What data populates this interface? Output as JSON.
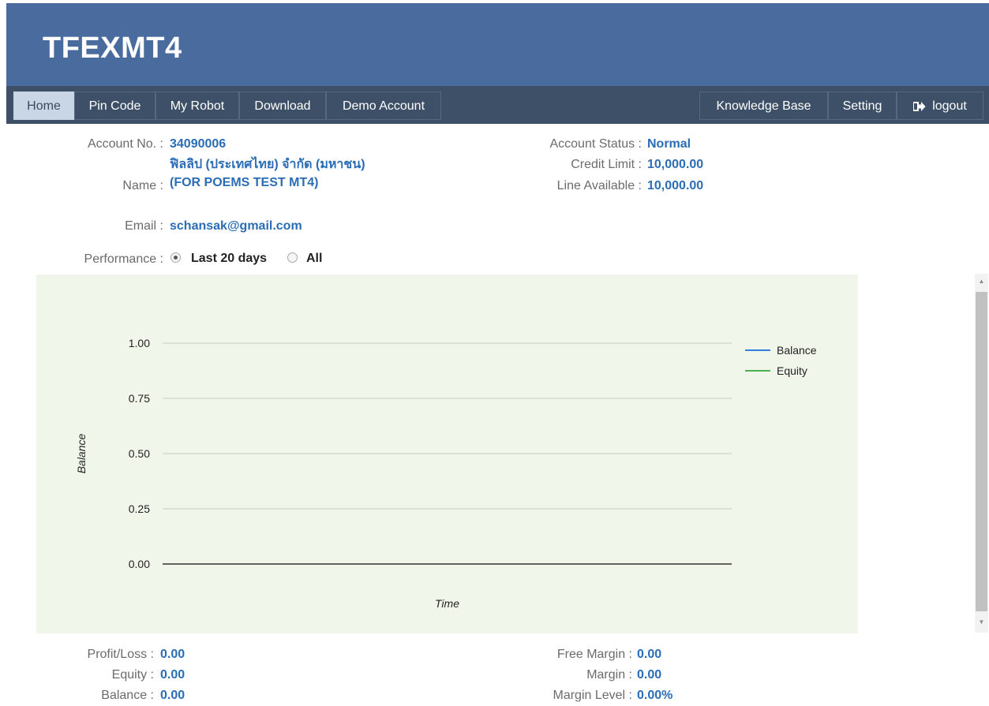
{
  "brand": "TFEXMT4",
  "nav": {
    "home": "Home",
    "pin_code": "Pin Code",
    "my_robot": "My Robot",
    "download": "Download",
    "demo_account": "Demo Account",
    "knowledge_base": "Knowledge Base",
    "setting": "Setting",
    "logout": "logout"
  },
  "account": {
    "account_no_label": "Account No. :",
    "account_no": "34090006",
    "name_label": "Name :",
    "name": "ฟิลลิป (ประเทศไทย) จำกัด (มหาชน) (FOR POEMS TEST MT4)",
    "email_label": "Email :",
    "email": "schansak@gmail.com",
    "status_label": "Account Status :",
    "status": "Normal",
    "credit_limit_label": "Credit Limit :",
    "credit_limit": "10,000.00",
    "line_available_label": "Line Available :",
    "line_available": "10,000.00"
  },
  "performance": {
    "label": "Performance :",
    "options": [
      "Last 20 days",
      "All"
    ],
    "selected": "Last 20 days"
  },
  "chart_data": {
    "type": "line",
    "title": "",
    "xlabel": "Time",
    "ylabel": "Balance",
    "ylim": [
      0,
      1
    ],
    "yticks": [
      "0.00",
      "0.25",
      "0.50",
      "0.75",
      "1.00"
    ],
    "grid": true,
    "legend_position": "right",
    "series": [
      {
        "name": "Balance",
        "color": "#2f80e0",
        "values": [
          0,
          0
        ]
      },
      {
        "name": "Equity",
        "color": "#4caf50",
        "values": [
          0,
          0
        ]
      }
    ]
  },
  "summary": {
    "profit_loss_label": "Profit/Loss :",
    "profit_loss": "0.00",
    "equity_label": "Equity :",
    "equity": "0.00",
    "balance_label": "Balance :",
    "balance": "0.00",
    "free_margin_label": "Free Margin :",
    "free_margin": "0.00",
    "margin_label": "Margin :",
    "margin": "0.00",
    "margin_level_label": "Margin Level :",
    "margin_level": "0.00%"
  }
}
